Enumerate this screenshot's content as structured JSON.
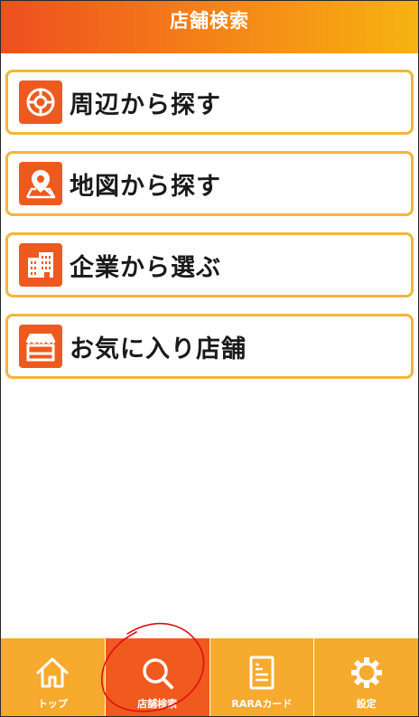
{
  "header": {
    "title": "店舗検索"
  },
  "menu": {
    "items": [
      {
        "label": "周辺から探す",
        "icon": "location-target-icon"
      },
      {
        "label": "地図から探す",
        "icon": "map-pin-icon"
      },
      {
        "label": "企業から選ぶ",
        "icon": "building-icon"
      },
      {
        "label": "お気に入り店舗",
        "icon": "storefront-icon"
      }
    ]
  },
  "tabbar": {
    "active": 1,
    "tabs": [
      {
        "label": "トップ",
        "icon": "home-icon"
      },
      {
        "label": "店舗検索",
        "icon": "search-icon"
      },
      {
        "label": "RARAカード",
        "icon": "card-document-icon"
      },
      {
        "label": "設定",
        "icon": "gear-icon"
      }
    ]
  },
  "colors": {
    "header_start": "#ee4f1f",
    "header_end": "#f6b311",
    "menu_border": "#f3b53a",
    "icon_bg": "#ee5a1e",
    "tabbar_bg": "#f6aa2e",
    "tab_active_bg": "#f05a1e",
    "annotation_stroke": "#e01010"
  }
}
